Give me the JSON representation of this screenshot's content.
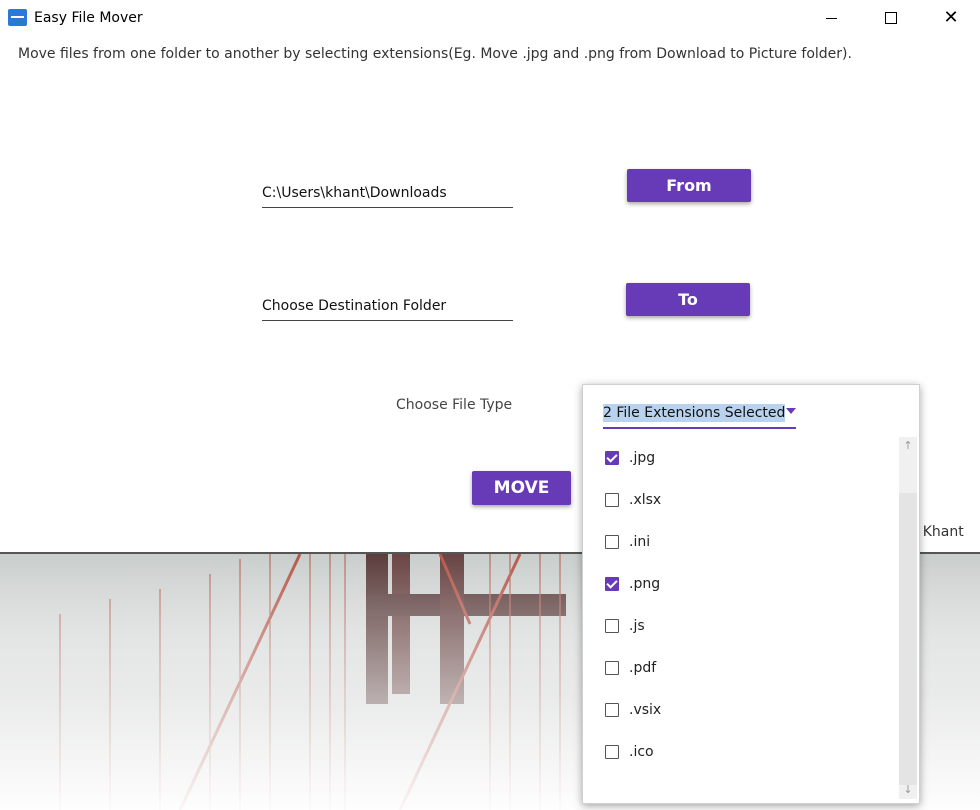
{
  "window": {
    "title": "Easy File Mover",
    "minimize_icon": "minimize-icon",
    "maximize_icon": "maximize-icon",
    "close_glyph": "✕"
  },
  "main": {
    "description": "Move files from one folder to another by selecting extensions(Eg. Move  .jpg and .png from Download to Picture folder).",
    "source_path": "C:\\Users\\khant\\Downloads",
    "from_label": "From",
    "destination_path": "Choose Destination Folder",
    "to_label": "To",
    "file_type_label": "Choose File Type",
    "move_label": "MOVE",
    "credit_fragment": "y Khant"
  },
  "dropdown": {
    "selected_text": "2 File Extensions Selected",
    "options": [
      {
        "label": ".jpg",
        "checked": true
      },
      {
        "label": ".xlsx",
        "checked": false
      },
      {
        "label": ".ini",
        "checked": false
      },
      {
        "label": ".png",
        "checked": true
      },
      {
        "label": ".js",
        "checked": false
      },
      {
        "label": ".pdf",
        "checked": false
      },
      {
        "label": ".vsix",
        "checked": false
      },
      {
        "label": ".ico",
        "checked": false
      }
    ],
    "scroll_up_glyph": "↑",
    "scroll_down_glyph": "↓"
  },
  "colors": {
    "accent": "#673ab7",
    "selection_highlight": "#b9d3ee"
  }
}
